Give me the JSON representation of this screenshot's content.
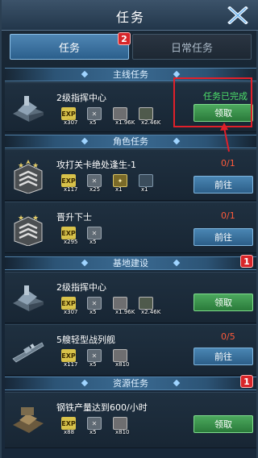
{
  "header": {
    "title": "任务"
  },
  "tabs": [
    {
      "label": "任务",
      "badge": "2",
      "active": true
    },
    {
      "label": "日常任务",
      "active": false
    }
  ],
  "sections": [
    {
      "label": "主线任务"
    },
    {
      "label": "角色任务"
    },
    {
      "label": "基地建设",
      "badge": "1"
    },
    {
      "label": "资源任务",
      "badge": "1"
    }
  ],
  "tasks": [
    {
      "title": "2级指挥中心",
      "status": "任务已完成",
      "button": "领取",
      "rewards": [
        {
          "icon": "exp-icon",
          "label": "EXP",
          "qty": "x307"
        },
        {
          "icon": "supply-box-icon",
          "label": "",
          "qty": "x5"
        },
        {
          "icon": "steel-icon",
          "label": "",
          "qty": "x1.96K"
        },
        {
          "icon": "fuel-icon",
          "label": "",
          "qty": "x2.46K"
        }
      ]
    },
    {
      "title": "攻打关卡绝处逢生-1",
      "progress": "0/1",
      "button": "前往",
      "rewards": [
        {
          "icon": "exp-icon",
          "label": "EXP",
          "qty": "x117"
        },
        {
          "icon": "supply-box-icon",
          "label": "",
          "qty": "x25"
        },
        {
          "icon": "medal-icon",
          "label": "",
          "qty": "x1"
        },
        {
          "icon": "ship-part-icon",
          "label": "",
          "qty": "x1"
        }
      ]
    },
    {
      "title": "晋升下士",
      "progress": "0/1",
      "button": "前往",
      "rewards": [
        {
          "icon": "exp-icon",
          "label": "EXP",
          "qty": "x295"
        },
        {
          "icon": "supply-box-icon",
          "label": "",
          "qty": "x5"
        }
      ]
    },
    {
      "title": "2级指挥中心",
      "button": "领取",
      "rewards": [
        {
          "icon": "exp-icon",
          "label": "EXP",
          "qty": "x307"
        },
        {
          "icon": "supply-box-icon",
          "label": "",
          "qty": "x5"
        },
        {
          "icon": "steel-icon",
          "label": "",
          "qty": "x1.96K"
        },
        {
          "icon": "fuel-icon",
          "label": "",
          "qty": "x2.46K"
        }
      ]
    },
    {
      "title": "5艘轻型战列舰",
      "progress": "0/5",
      "button": "前往",
      "rewards": [
        {
          "icon": "exp-icon",
          "label": "EXP",
          "qty": "x117"
        },
        {
          "icon": "supply-box-icon",
          "label": "",
          "qty": "x5"
        },
        {
          "icon": "steel-icon",
          "label": "",
          "qty": "x810"
        }
      ]
    },
    {
      "title": "钢铁产量达到600/小时",
      "button": "领取",
      "rewards": [
        {
          "icon": "exp-icon",
          "label": "EXP",
          "qty": "x88"
        },
        {
          "icon": "supply-box-icon",
          "label": "",
          "qty": "x5"
        },
        {
          "icon": "steel-icon",
          "label": "",
          "qty": "x810"
        }
      ]
    }
  ],
  "colors": {
    "accent_blue": "#2c5e88",
    "accent_green": "#2a7a3a",
    "complete_text": "#4ee06a",
    "progress_text": "#ff5a3a",
    "badge_red": "#d8262a",
    "highlight_red": "#e0202a"
  }
}
